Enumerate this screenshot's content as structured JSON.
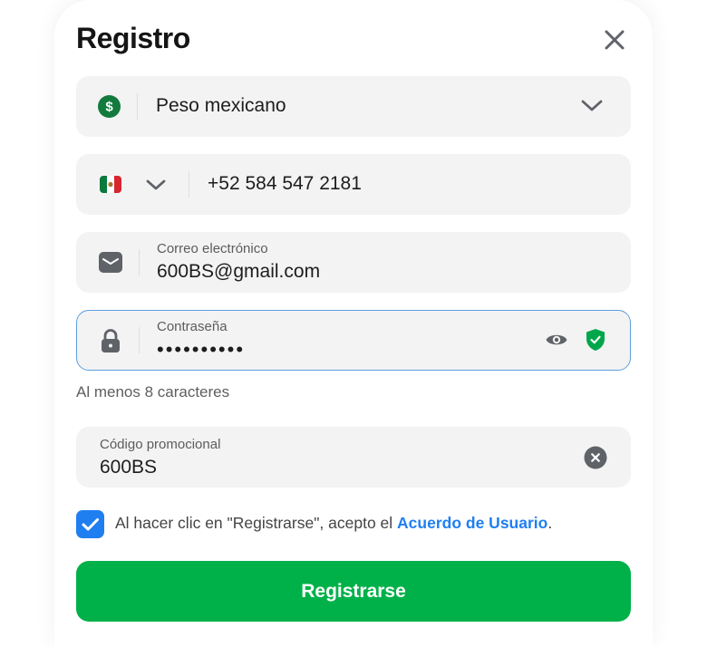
{
  "modal": {
    "title": "Registro"
  },
  "currency": {
    "icon": "dollar-coin-icon",
    "value": "Peso mexicano"
  },
  "phone": {
    "country_flag": "mexico-flag-icon",
    "value": "+52 584 547 2181"
  },
  "email": {
    "label": "Correo electrónico",
    "value": "600BS@gmail.com"
  },
  "password": {
    "label": "Contraseña",
    "value": "••••••••••",
    "hint": "Al menos 8 caracteres"
  },
  "promo": {
    "label": "Código promocional",
    "value": "600BS"
  },
  "terms": {
    "checked": true,
    "text": "Al hacer clic en \"Registrarse\", acepto el ",
    "link": "Acuerdo de Usuario",
    "suffix": "."
  },
  "submit_label": "Registrarse",
  "colors": {
    "accent_blue": "#1f7ff0",
    "success_green": "#00b149",
    "field_bg": "#f3f3f4",
    "focus_border": "#5b9ee0"
  }
}
